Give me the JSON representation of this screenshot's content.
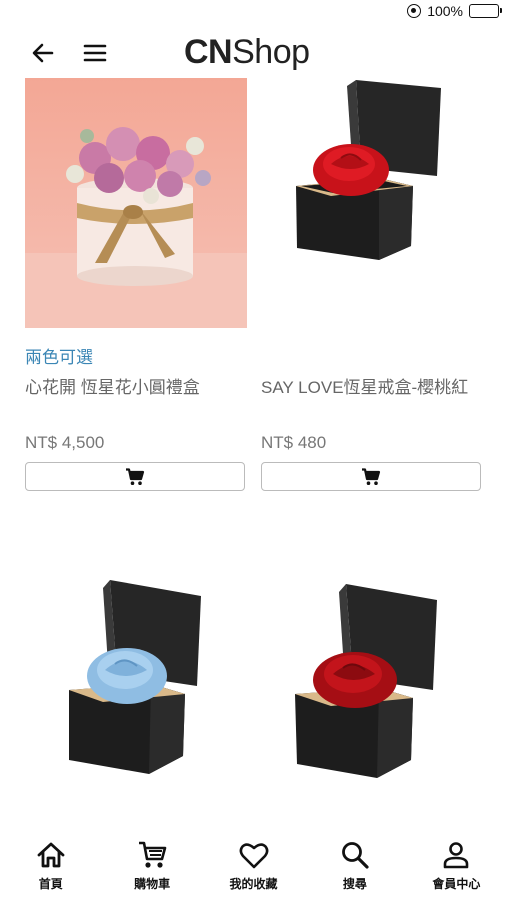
{
  "status": {
    "battery": "100%"
  },
  "header": {
    "logo_bold": "CN",
    "logo_light": "Shop"
  },
  "products": [
    {
      "badge": "兩色可選",
      "name": "心花開 恆星花小圓禮盒",
      "price": "NT$ 4,500",
      "image": "pink-flower-round-box"
    },
    {
      "badge": "",
      "name": "SAY LOVE恆星戒盒-櫻桃紅",
      "price": "NT$ 480",
      "image": "red-rose-ring-box"
    },
    {
      "badge": "",
      "name": "",
      "price": "",
      "image": "blue-rose-ring-box"
    },
    {
      "badge": "",
      "name": "",
      "price": "",
      "image": "red-rose-ring-box-open"
    }
  ],
  "nav": [
    {
      "label": "首頁",
      "icon": "home-icon"
    },
    {
      "label": "購物車",
      "icon": "cart-icon"
    },
    {
      "label": "我的收藏",
      "icon": "heart-icon"
    },
    {
      "label": "搜尋",
      "icon": "search-icon"
    },
    {
      "label": "會員中心",
      "icon": "user-icon"
    }
  ],
  "colors": {
    "badge": "#3b86b5",
    "text": "#666666",
    "rose_red": "#d8141c",
    "rose_blue": "#9cc6e8",
    "pink_bg": "#f0a89a"
  }
}
